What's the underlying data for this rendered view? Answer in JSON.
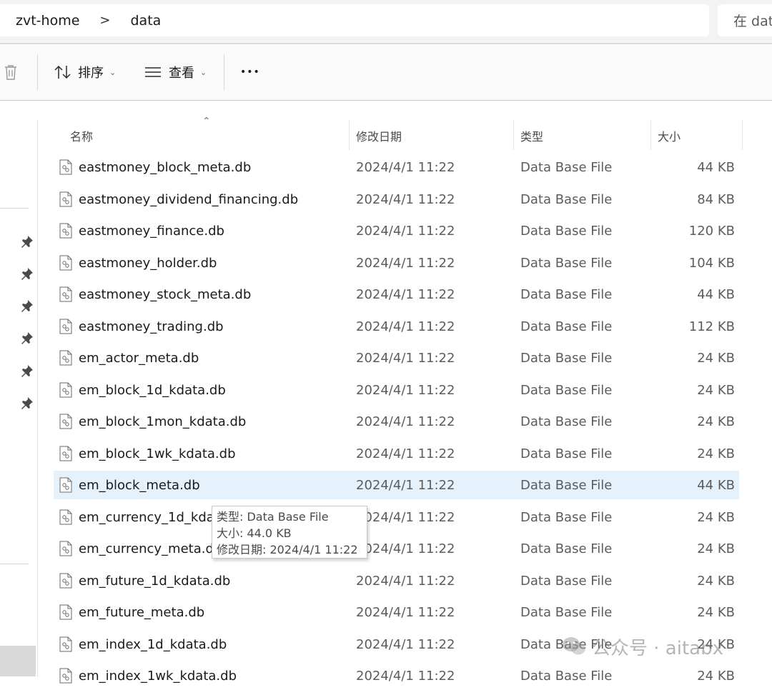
{
  "address_bar": {
    "breadcrumb": [
      "zvt-home",
      "data"
    ],
    "separator": ">",
    "search_placeholder": "在 dat"
  },
  "toolbar": {
    "sort_label": "排序",
    "view_label": "查看",
    "more_label": "•••"
  },
  "columns": {
    "name": "名称",
    "date_modified": "修改日期",
    "type": "类型",
    "size": "大小"
  },
  "files": [
    {
      "name": "eastmoney_block_meta.db",
      "date": "2024/4/1 11:22",
      "type": "Data Base File",
      "size": "44 KB"
    },
    {
      "name": "eastmoney_dividend_financing.db",
      "date": "2024/4/1 11:22",
      "type": "Data Base File",
      "size": "84 KB"
    },
    {
      "name": "eastmoney_finance.db",
      "date": "2024/4/1 11:22",
      "type": "Data Base File",
      "size": "120 KB"
    },
    {
      "name": "eastmoney_holder.db",
      "date": "2024/4/1 11:22",
      "type": "Data Base File",
      "size": "104 KB"
    },
    {
      "name": "eastmoney_stock_meta.db",
      "date": "2024/4/1 11:22",
      "type": "Data Base File",
      "size": "44 KB"
    },
    {
      "name": "eastmoney_trading.db",
      "date": "2024/4/1 11:22",
      "type": "Data Base File",
      "size": "112 KB"
    },
    {
      "name": "em_actor_meta.db",
      "date": "2024/4/1 11:22",
      "type": "Data Base File",
      "size": "24 KB"
    },
    {
      "name": "em_block_1d_kdata.db",
      "date": "2024/4/1 11:22",
      "type": "Data Base File",
      "size": "24 KB"
    },
    {
      "name": "em_block_1mon_kdata.db",
      "date": "2024/4/1 11:22",
      "type": "Data Base File",
      "size": "24 KB"
    },
    {
      "name": "em_block_1wk_kdata.db",
      "date": "2024/4/1 11:22",
      "type": "Data Base File",
      "size": "24 KB"
    },
    {
      "name": "em_block_meta.db",
      "date": "2024/4/1 11:22",
      "type": "Data Base File",
      "size": "44 KB",
      "selected": true
    },
    {
      "name": "em_currency_1d_kdata",
      "date": "2024/4/1 11:22",
      "type": "Data Base File",
      "size": "24 KB"
    },
    {
      "name": "em_currency_meta.db",
      "date": "2024/4/1 11:22",
      "type": "Data Base File",
      "size": "24 KB"
    },
    {
      "name": "em_future_1d_kdata.db",
      "date": "2024/4/1 11:22",
      "type": "Data Base File",
      "size": "24 KB"
    },
    {
      "name": "em_future_meta.db",
      "date": "2024/4/1 11:22",
      "type": "Data Base File",
      "size": "24 KB"
    },
    {
      "name": "em_index_1d_kdata.db",
      "date": "2024/4/1 11:22",
      "type": "Data Base File",
      "size": "24 KB"
    },
    {
      "name": "em_index_1wk_kdata.db",
      "date": "2024/4/1 11:22",
      "type": "Data Base File",
      "size": "24 KB"
    }
  ],
  "tooltip": {
    "type_line": "类型: Data Base File",
    "size_line": "大小: 44.0 KB",
    "date_line": "修改日期: 2024/4/1 11:22"
  },
  "watermark": {
    "text": "公众号 · aitabx"
  },
  "icons": {
    "delete": "trash-icon",
    "sort": "sort-arrows-icon",
    "view": "view-list-icon",
    "more": "more-icon",
    "pin": "pin-icon",
    "file": "db-file-icon"
  },
  "colors": {
    "selected_row": "#e5f1fb",
    "address_bg": "#f3f3f3",
    "toolbar_bg": "#fafafa"
  }
}
